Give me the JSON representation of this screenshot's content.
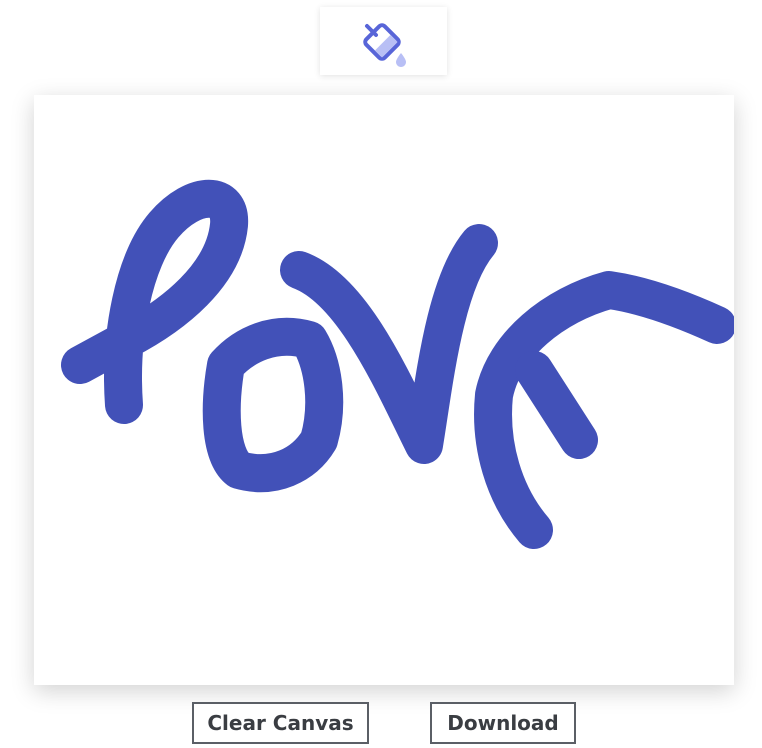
{
  "toolbar": {
    "color_picker_icon": "paint-bucket-icon",
    "icon_color": "#5865d8",
    "icon_fill_color": "#b8bff5"
  },
  "canvas": {
    "stroke_color": "#4251b8",
    "background": "#ffffff"
  },
  "buttons": {
    "clear_label": "Clear Canvas",
    "download_label": "Download"
  }
}
